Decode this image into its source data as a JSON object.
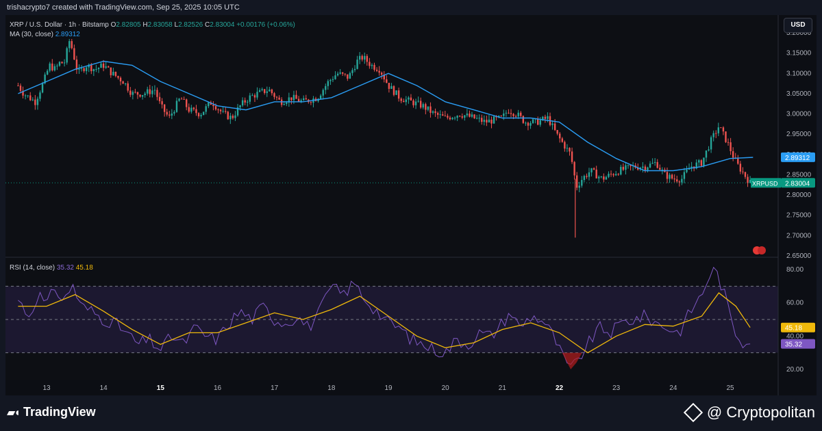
{
  "header": {
    "author_line": "trishacrypto7 created with TradingView.com, Sep 25, 2025 10:05 UTC"
  },
  "legend": {
    "symbol": "XRP / U.S. Dollar · 1h · Bitstamp",
    "o_label": "O",
    "o_value": "2.82805",
    "h_label": "H",
    "h_value": "2.83058",
    "l_label": "L",
    "l_value": "2.82526",
    "c_label": "C",
    "c_value": "2.83004",
    "change": "+0.00176 (+0.06%)",
    "ma_label": "MA (30, close)",
    "ma_value": "2.89312",
    "rsi_label": "RSI (14, close)",
    "rsi_value": "35.32",
    "rsi_ma_value": "45.18"
  },
  "currency_button": "USD",
  "branding": {
    "tradingview": "TradingView",
    "cryptopolitan": "@ Cryptopolitan"
  },
  "colors": {
    "up": "#26a69a",
    "down": "#ef5350",
    "ma": "#2a9df4",
    "rsi": "#7e57c2",
    "rsi_ma": "#f0b90b",
    "last_price": "#089981"
  },
  "chart_data": {
    "type": "candlestick",
    "interval": "1h",
    "price_axis": {
      "ylim": [
        2.65,
        3.2
      ],
      "ticks": [
        "3.20000",
        "3.15000",
        "3.10000",
        "3.05000",
        "3.00000",
        "2.95000",
        "2.90000",
        "2.85000",
        "2.80000",
        "2.75000",
        "2.70000",
        "2.65000"
      ]
    },
    "x_axis": {
      "ticks": [
        "13",
        "14",
        "15",
        "16",
        "17",
        "18",
        "19",
        "20",
        "21",
        "22",
        "23",
        "24",
        "25"
      ],
      "bold_ticks": [
        "15",
        "22"
      ]
    },
    "last_price": {
      "label": "XRPUSD",
      "value": "2.83004",
      "y": 2.83004
    },
    "ma_badge": {
      "value": "2.89312",
      "y": 2.89312
    },
    "price_path": [
      [
        12.5,
        3.07
      ],
      [
        12.6,
        3.05
      ],
      [
        12.7,
        3.04
      ],
      [
        12.8,
        3.03
      ],
      [
        12.95,
        3.08
      ],
      [
        13.05,
        3.12
      ],
      [
        13.15,
        3.11
      ],
      [
        13.25,
        3.13
      ],
      [
        13.3,
        3.12
      ],
      [
        13.4,
        3.18
      ],
      [
        13.45,
        3.16
      ],
      [
        13.55,
        3.1
      ],
      [
        13.7,
        3.12
      ],
      [
        13.85,
        3.11
      ],
      [
        14.0,
        3.12
      ],
      [
        14.15,
        3.1
      ],
      [
        14.35,
        3.08
      ],
      [
        14.5,
        3.05
      ],
      [
        14.7,
        3.05
      ],
      [
        14.9,
        3.06
      ],
      [
        15.0,
        3.02
      ],
      [
        15.15,
        2.99
      ],
      [
        15.35,
        3.04
      ],
      [
        15.5,
        3.01
      ],
      [
        15.7,
        3.0
      ],
      [
        15.9,
        3.03
      ],
      [
        16.1,
        3.0
      ],
      [
        16.25,
        2.99
      ],
      [
        16.4,
        3.02
      ],
      [
        16.55,
        3.04
      ],
      [
        16.7,
        3.05
      ],
      [
        16.9,
        3.06
      ],
      [
        17.1,
        3.03
      ],
      [
        17.3,
        3.04
      ],
      [
        17.5,
        3.03
      ],
      [
        17.75,
        3.04
      ],
      [
        17.95,
        3.08
      ],
      [
        18.1,
        3.1
      ],
      [
        18.3,
        3.09
      ],
      [
        18.45,
        3.13
      ],
      [
        18.55,
        3.14
      ],
      [
        18.7,
        3.12
      ],
      [
        18.85,
        3.11
      ],
      [
        19.0,
        3.07
      ],
      [
        19.2,
        3.04
      ],
      [
        19.4,
        3.03
      ],
      [
        19.6,
        3.02
      ],
      [
        19.8,
        3.0
      ],
      [
        20.0,
        2.99
      ],
      [
        20.25,
        3.0
      ],
      [
        20.5,
        2.99
      ],
      [
        20.7,
        2.98
      ],
      [
        21.0,
        2.99
      ],
      [
        21.1,
        3.01
      ],
      [
        21.25,
        3.0
      ],
      [
        21.4,
        2.98
      ],
      [
        21.6,
        2.98
      ],
      [
        21.8,
        2.99
      ],
      [
        21.95,
        2.95
      ],
      [
        22.05,
        2.93
      ],
      [
        22.2,
        2.9
      ],
      [
        22.3,
        2.82
      ],
      [
        22.4,
        2.84
      ],
      [
        22.55,
        2.86
      ],
      [
        22.75,
        2.84
      ],
      [
        22.9,
        2.85
      ],
      [
        23.05,
        2.86
      ],
      [
        23.3,
        2.87
      ],
      [
        23.5,
        2.87
      ],
      [
        23.7,
        2.88
      ],
      [
        23.85,
        2.85
      ],
      [
        24.0,
        2.84
      ],
      [
        24.15,
        2.84
      ],
      [
        24.3,
        2.87
      ],
      [
        24.5,
        2.88
      ],
      [
        24.65,
        2.93
      ],
      [
        24.8,
        2.97
      ],
      [
        24.95,
        2.93
      ],
      [
        25.1,
        2.88
      ],
      [
        25.25,
        2.85
      ],
      [
        25.35,
        2.83
      ]
    ],
    "ma_path": [
      [
        12.5,
        3.05
      ],
      [
        13.0,
        3.08
      ],
      [
        13.5,
        3.11
      ],
      [
        14.0,
        3.13
      ],
      [
        14.5,
        3.12
      ],
      [
        15.0,
        3.08
      ],
      [
        15.5,
        3.05
      ],
      [
        16.0,
        3.02
      ],
      [
        16.5,
        3.01
      ],
      [
        17.0,
        3.03
      ],
      [
        17.5,
        3.03
      ],
      [
        18.0,
        3.04
      ],
      [
        18.5,
        3.07
      ],
      [
        19.0,
        3.1
      ],
      [
        19.5,
        3.07
      ],
      [
        20.0,
        3.03
      ],
      [
        20.5,
        3.01
      ],
      [
        21.0,
        2.99
      ],
      [
        21.5,
        2.99
      ],
      [
        22.0,
        2.98
      ],
      [
        22.5,
        2.93
      ],
      [
        23.0,
        2.89
      ],
      [
        23.5,
        2.86
      ],
      [
        24.0,
        2.86
      ],
      [
        24.5,
        2.87
      ],
      [
        25.0,
        2.89
      ],
      [
        25.4,
        2.893
      ]
    ],
    "rsi_axis": {
      "ylim": [
        15,
        85
      ],
      "ticks": [
        "80.00",
        "60.00",
        "40.00",
        "20.00"
      ],
      "bands": [
        30,
        50,
        70
      ]
    },
    "rsi_badges": [
      {
        "value": "45.18",
        "y": 45.18,
        "series": "rsi_ma"
      },
      {
        "value": "35.32",
        "y": 35.32,
        "series": "rsi"
      }
    ],
    "rsi_path": [
      [
        12.5,
        62
      ],
      [
        12.7,
        52
      ],
      [
        12.85,
        66
      ],
      [
        13.0,
        58
      ],
      [
        13.15,
        70
      ],
      [
        13.3,
        60
      ],
      [
        13.45,
        72
      ],
      [
        13.6,
        58
      ],
      [
        13.8,
        55
      ],
      [
        14.0,
        50
      ],
      [
        14.2,
        48
      ],
      [
        14.4,
        42
      ],
      [
        14.6,
        35
      ],
      [
        14.8,
        38
      ],
      [
        15.0,
        32
      ],
      [
        15.2,
        40
      ],
      [
        15.4,
        35
      ],
      [
        15.6,
        45
      ],
      [
        15.8,
        40
      ],
      [
        16.0,
        38
      ],
      [
        16.2,
        48
      ],
      [
        16.4,
        55
      ],
      [
        16.6,
        50
      ],
      [
        16.8,
        58
      ],
      [
        17.0,
        50
      ],
      [
        17.2,
        48
      ],
      [
        17.4,
        52
      ],
      [
        17.6,
        45
      ],
      [
        17.8,
        55
      ],
      [
        18.0,
        70
      ],
      [
        18.2,
        65
      ],
      [
        18.4,
        72
      ],
      [
        18.6,
        62
      ],
      [
        18.8,
        55
      ],
      [
        19.0,
        48
      ],
      [
        19.2,
        45
      ],
      [
        19.4,
        38
      ],
      [
        19.6,
        35
      ],
      [
        19.8,
        32
      ],
      [
        20.0,
        30
      ],
      [
        20.2,
        38
      ],
      [
        20.4,
        35
      ],
      [
        20.6,
        42
      ],
      [
        20.8,
        40
      ],
      [
        21.0,
        48
      ],
      [
        21.15,
        55
      ],
      [
        21.3,
        45
      ],
      [
        21.5,
        52
      ],
      [
        21.7,
        50
      ],
      [
        21.9,
        40
      ],
      [
        22.05,
        28
      ],
      [
        22.2,
        20
      ],
      [
        22.3,
        24
      ],
      [
        22.5,
        35
      ],
      [
        22.7,
        45
      ],
      [
        22.9,
        42
      ],
      [
        23.1,
        48
      ],
      [
        23.3,
        50
      ],
      [
        23.5,
        52
      ],
      [
        23.7,
        48
      ],
      [
        23.9,
        45
      ],
      [
        24.1,
        42
      ],
      [
        24.3,
        55
      ],
      [
        24.5,
        65
      ],
      [
        24.65,
        78
      ],
      [
        24.75,
        80
      ],
      [
        24.9,
        65
      ],
      [
        25.0,
        52
      ],
      [
        25.1,
        42
      ],
      [
        25.25,
        35
      ],
      [
        25.35,
        35.32
      ]
    ],
    "rsi_ma_path": [
      [
        12.5,
        58
      ],
      [
        13.0,
        58
      ],
      [
        13.5,
        65
      ],
      [
        14.0,
        55
      ],
      [
        14.5,
        44
      ],
      [
        15.0,
        35
      ],
      [
        15.5,
        42
      ],
      [
        16.0,
        42
      ],
      [
        16.5,
        48
      ],
      [
        17.0,
        54
      ],
      [
        17.5,
        50
      ],
      [
        18.0,
        56
      ],
      [
        18.5,
        64
      ],
      [
        19.0,
        52
      ],
      [
        19.5,
        40
      ],
      [
        20.0,
        33
      ],
      [
        20.5,
        36
      ],
      [
        21.0,
        44
      ],
      [
        21.5,
        48
      ],
      [
        22.0,
        42
      ],
      [
        22.5,
        30
      ],
      [
        23.0,
        40
      ],
      [
        23.5,
        47
      ],
      [
        24.0,
        46
      ],
      [
        24.5,
        52
      ],
      [
        24.8,
        66
      ],
      [
        25.1,
        58
      ],
      [
        25.35,
        45.18
      ]
    ]
  }
}
